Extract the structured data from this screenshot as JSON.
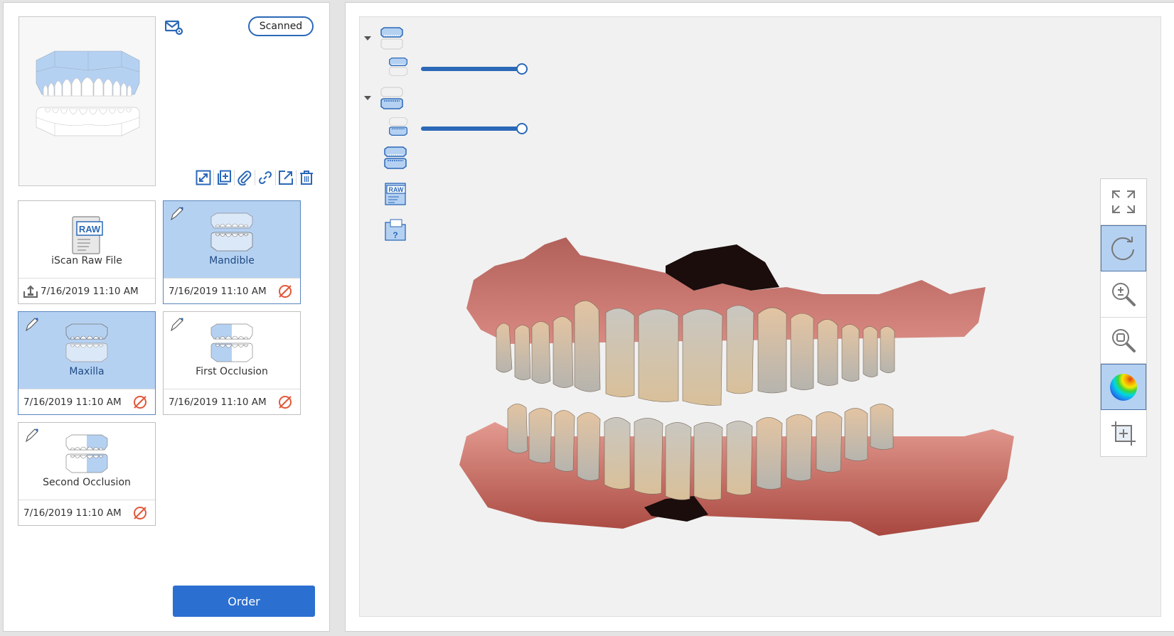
{
  "header": {
    "status_badge": "Scanned",
    "icons": {
      "mail_settings": "mail-settings-icon"
    },
    "actions": [
      {
        "name": "expand-icon",
        "label": "Expand"
      },
      {
        "name": "add-copy-icon",
        "label": "Add"
      },
      {
        "name": "attach-icon",
        "label": "Attach"
      },
      {
        "name": "link-icon",
        "label": "Link"
      },
      {
        "name": "export-icon",
        "label": "Export"
      },
      {
        "name": "delete-icon",
        "label": "Delete"
      }
    ]
  },
  "cards": [
    {
      "label": "iScan Raw File",
      "timestamp": "7/16/2019 11:10 AM",
      "selected": false,
      "icon": "raw-file-icon",
      "footer_icon": "upload-icon"
    },
    {
      "label": "Mandible",
      "timestamp": "7/16/2019 11:10 AM",
      "selected": true,
      "icon": "mandible-icon",
      "footer_icon": "cancel-icon"
    },
    {
      "label": "Maxilla",
      "timestamp": "7/16/2019 11:10 AM",
      "selected": true,
      "icon": "maxilla-icon",
      "footer_icon": "cancel-icon"
    },
    {
      "label": "First Occlusion",
      "timestamp": "7/16/2019 11:10 AM",
      "selected": false,
      "icon": "first-occlusion-icon",
      "footer_icon": "cancel-icon"
    },
    {
      "label": "Second Occlusion",
      "timestamp": "7/16/2019 11:10 AM",
      "selected": false,
      "icon": "second-occlusion-icon",
      "footer_icon": "cancel-icon"
    }
  ],
  "order_button": "Order",
  "layers": {
    "upper_group": {
      "expanded": true,
      "opacity": 1.0
    },
    "lower_group": {
      "expanded": true,
      "opacity": 1.0
    },
    "raw_label": "RAW",
    "help_label": "?"
  },
  "toolbar": [
    {
      "name": "fit-view-icon",
      "active": false
    },
    {
      "name": "rotate-icon",
      "active": true
    },
    {
      "name": "zoom-icon",
      "active": false
    },
    {
      "name": "zoom-window-icon",
      "active": false
    },
    {
      "name": "color-map-icon",
      "active": true
    },
    {
      "name": "crop-icon",
      "active": false
    }
  ],
  "colors": {
    "accent": "#2b68b7",
    "button": "#2b6fd0",
    "selected_bg": "#b5d1f2",
    "cancel": "#e2583a"
  }
}
